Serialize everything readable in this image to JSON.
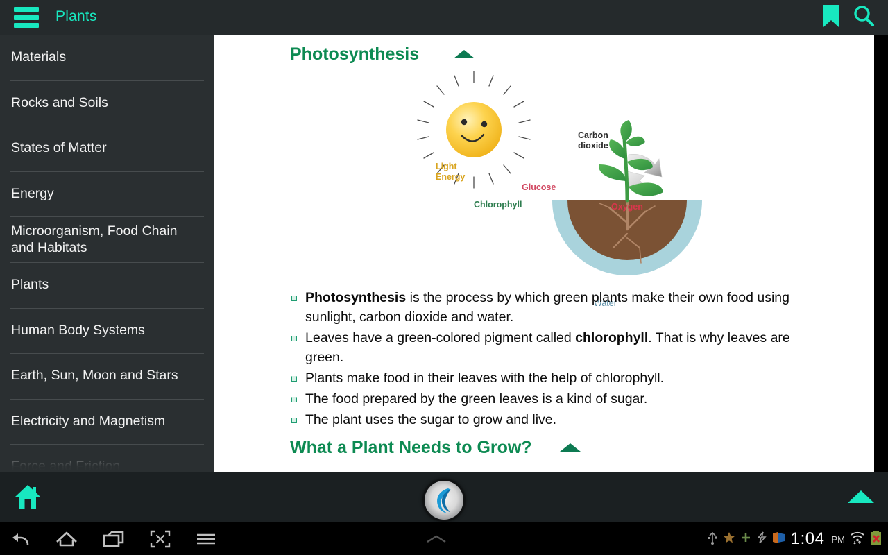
{
  "topbar": {
    "menu_icon": "hamburger-menu-icon",
    "title": "Plants",
    "bookmark_icon": "bookmark-icon",
    "search_icon": "search-icon",
    "accent_color": "#18e8c0"
  },
  "sidebar": {
    "items": [
      {
        "label": "Materials"
      },
      {
        "label": "Rocks and Soils"
      },
      {
        "label": "States of Matter"
      },
      {
        "label": "Energy"
      },
      {
        "label": "Microorganism, Food Chain and Habitats"
      },
      {
        "label": "Plants"
      },
      {
        "label": "Human Body Systems"
      },
      {
        "label": "Earth, Sun, Moon and Stars"
      },
      {
        "label": "Electricity and Magnetism"
      },
      {
        "label": "Force and Friction"
      }
    ]
  },
  "content": {
    "section1": {
      "heading": "Photosynthesis",
      "collapse_icon": "caret-up-icon"
    },
    "diagram": {
      "name": "photosynthesis-diagram",
      "labels": {
        "light_energy": "Light\nEnergy",
        "light_energy_line1": "Light",
        "light_energy_line2": "Energy",
        "glucose": "Glucose",
        "carbon_dioxide_line1": "Carbon",
        "carbon_dioxide_line2": "dioxide",
        "chlorophyll": "Chlorophyll",
        "oxygen": "Oxygen",
        "water": "Water"
      },
      "colors": {
        "light_energy": "#d9a520",
        "glucose": "#d24a63",
        "carbon_dioxide": "#2b2b2b",
        "chlorophyll": "#2e7d4f",
        "oxygen": "#d9364c",
        "water": "#5b8fa8",
        "sun": "#f6c833",
        "leaf": "#3faa4a",
        "soil": "#7b5234",
        "water_fill": "#a9d3dc"
      }
    },
    "bullets": [
      {
        "bold_lead": "Photosynthesis",
        "text": " is the process by which green plants make their own food using sunlight, carbon dioxide and water."
      },
      {
        "pre": "Leaves have a green-colored pigment called ",
        "bold_mid": "chlorophyll",
        "post": ". That is why leaves are green."
      },
      {
        "text": "Plants make food in their leaves with the help of chlorophyll."
      },
      {
        "text": "The food prepared by the green leaves is a kind of sugar."
      },
      {
        "text": "The plant uses the sugar to grow and live."
      }
    ],
    "section2": {
      "heading": "What a Plant Needs to Grow?",
      "collapse_icon": "caret-up-icon"
    },
    "heading_color": "#0d8a52"
  },
  "bottombar": {
    "home_icon": "home-icon",
    "scroll_top_icon": "caret-up-icon",
    "browser_orb_icon": "browser-orb-icon"
  },
  "navbar": {
    "back_icon": "back-arrow-icon",
    "home_icon": "home-outline-icon",
    "recents_icon": "recent-apps-icon",
    "screenshot_icon": "screenshot-capture-icon",
    "menu_icon": "menu-lines-icon",
    "expand_icon": "chevron-up-icon",
    "tray": {
      "usb_icon": "usb-icon",
      "star_icon": "star-icon",
      "plus_icon": "plus-icon",
      "flash_icon": "flash-icon",
      "hdmi_icon": "screen-cast-icon",
      "time": "1:04",
      "meridiem": "PM",
      "wifi_icon": "wifi-icon",
      "battery_icon": "battery-error-icon"
    }
  }
}
